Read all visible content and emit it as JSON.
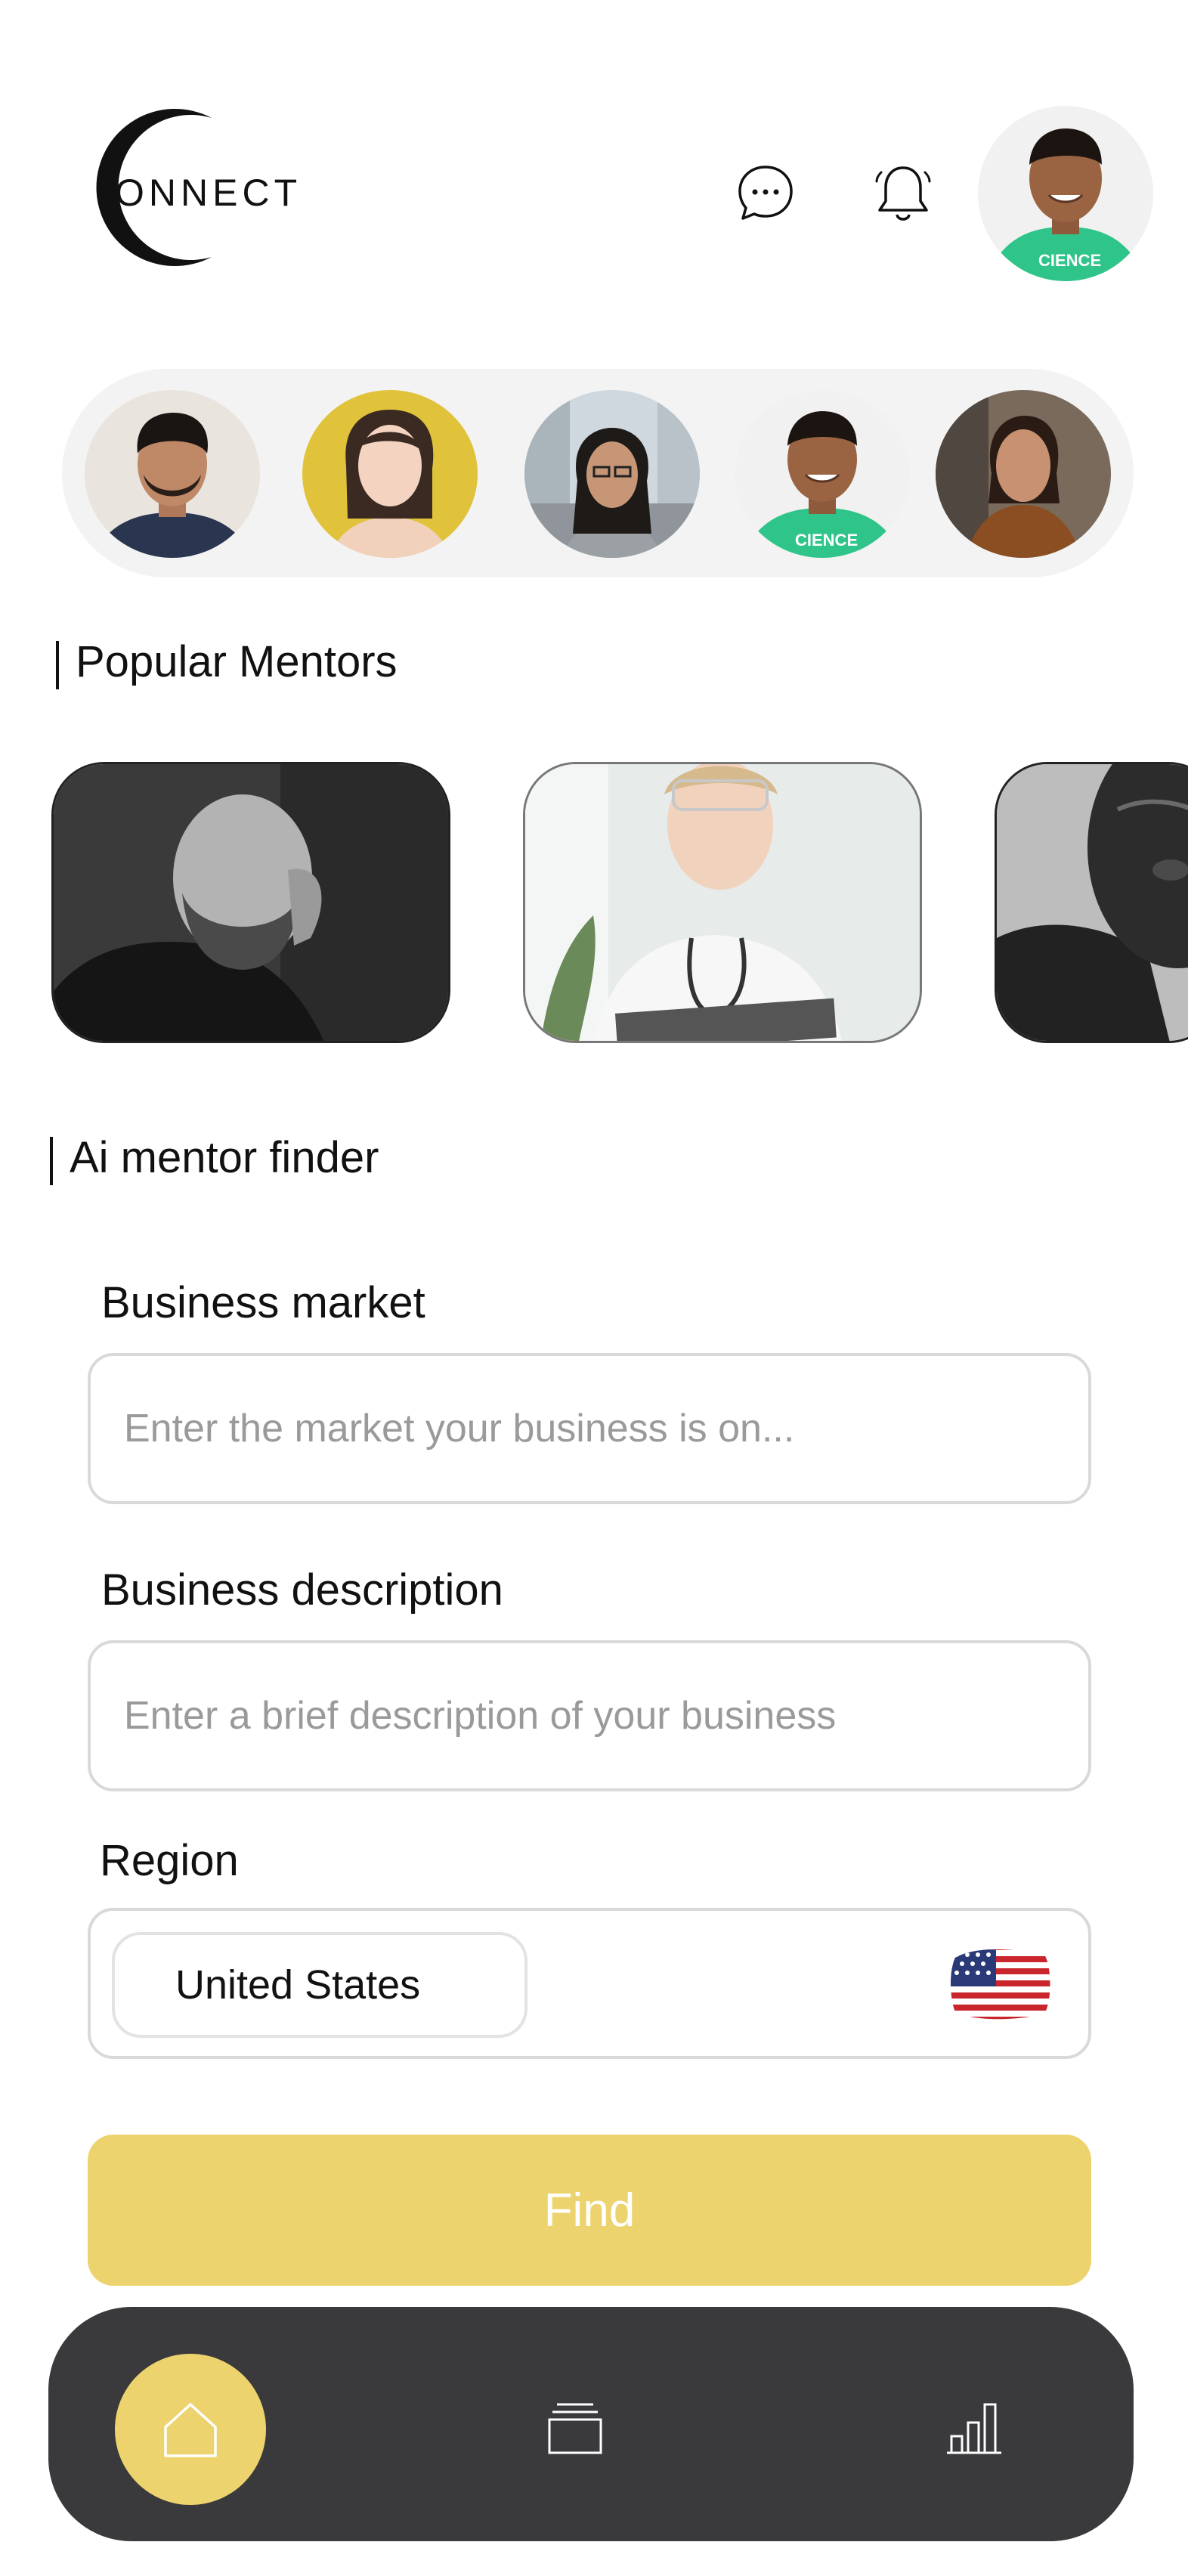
{
  "app": {
    "logo_text": "ONNECT"
  },
  "header": {
    "chat_icon": "chat-bubble-icon",
    "bell_icon": "bell-icon"
  },
  "stories": {
    "count": 5
  },
  "popular_mentors": {
    "title": "Popular Mentors"
  },
  "mentor_finder": {
    "title": "Ai mentor finder",
    "market": {
      "label": "Business market",
      "placeholder": "Enter the market your business is on...",
      "value": ""
    },
    "description": {
      "label": "Business description",
      "placeholder": "Enter a brief description of your business",
      "value": ""
    },
    "region": {
      "label": "Region",
      "value": "United States",
      "flag_icon": "us-flag-icon"
    },
    "find_label": "Find"
  },
  "nav": {
    "items": [
      {
        "icon": "home-icon",
        "active": true
      },
      {
        "icon": "cards-stack-icon",
        "active": false
      },
      {
        "icon": "bar-chart-icon",
        "active": false
      }
    ]
  },
  "colors": {
    "accent": "#edd36e",
    "nav_bg": "#3a3a3c",
    "story_strip_bg": "#f3f3f3",
    "field_border": "#d9d9d9"
  }
}
